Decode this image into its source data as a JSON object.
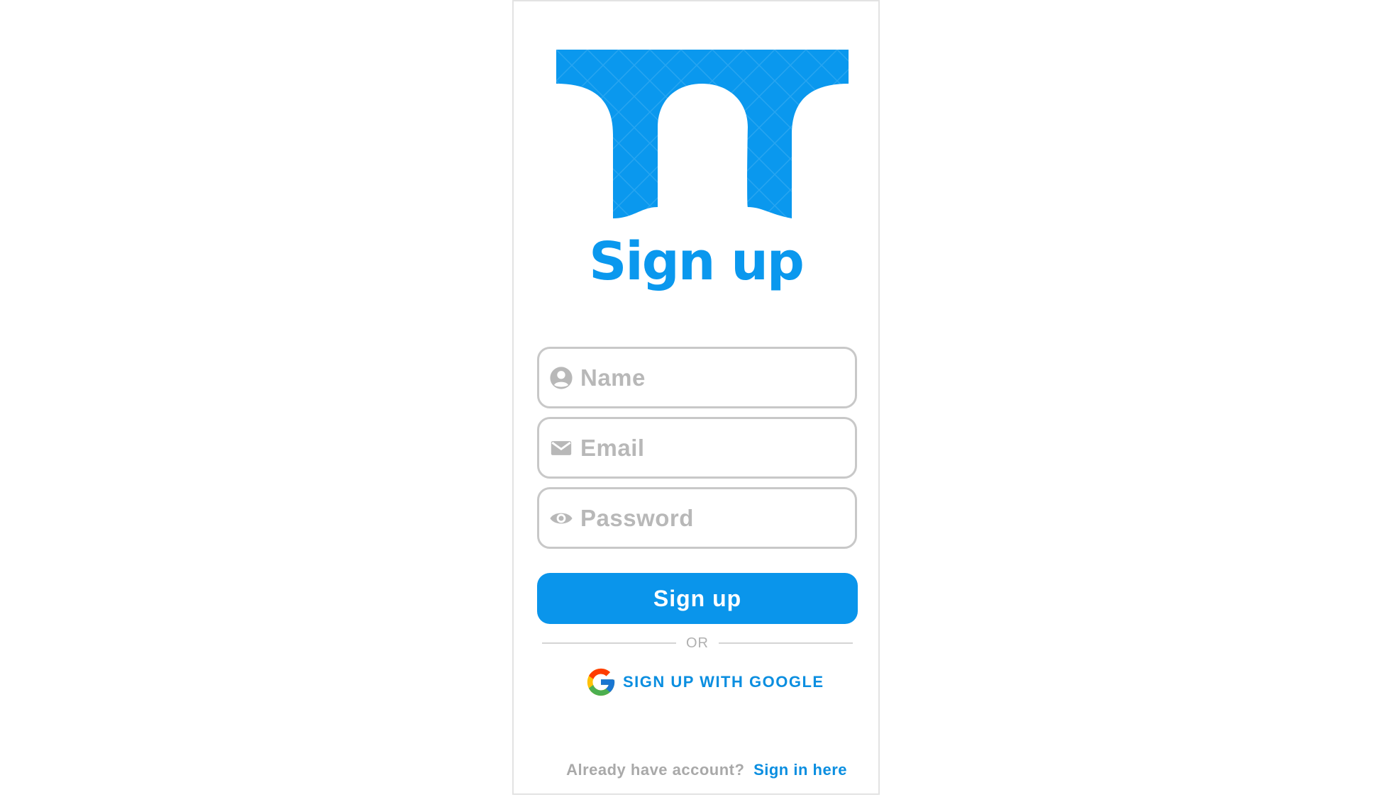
{
  "brand": {
    "accent_color": "#0a98ee",
    "logo_icon": "bridge-arch-logo"
  },
  "header": {
    "title": "Sign up"
  },
  "form": {
    "name": {
      "placeholder": "Name",
      "icon": "account-circle-icon"
    },
    "email": {
      "placeholder": "Email",
      "icon": "mail-icon"
    },
    "password": {
      "placeholder": "Password",
      "icon": "eye-icon"
    },
    "submit_label": "Sign up"
  },
  "divider": {
    "label": "OR"
  },
  "google": {
    "label": "SIGN UP WITH GOOGLE",
    "icon": "google-g-icon"
  },
  "footer": {
    "prompt": "Already have account?",
    "link_label": "Sign in here"
  }
}
